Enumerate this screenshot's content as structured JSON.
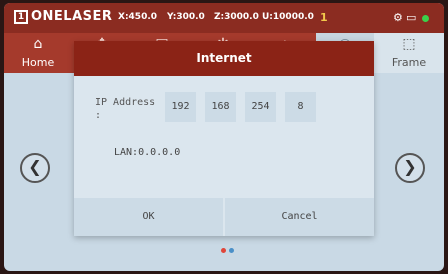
{
  "header": {
    "logo_mark": "1",
    "logo_text": "ONELASER",
    "x": "X:450.0",
    "y": "Y:300.0",
    "z": "Z:3000.0",
    "u": "U:10000.0",
    "num": "1",
    "icons": [
      "settings-gear-icon",
      "folder-icon"
    ],
    "status_color": "#3bd14a"
  },
  "tabs": {
    "home_label": "Home",
    "frame_label": "Frame"
  },
  "dialog": {
    "title": "Internet",
    "ip_label": "IP Address :",
    "ip": [
      "192",
      "168",
      "254",
      "8"
    ],
    "lan": "LAN:0.0.0.0",
    "ok_label": "OK",
    "cancel_label": "Cancel"
  },
  "colors": {
    "accent": "#8b2c21",
    "background": "#c9d9e5"
  }
}
